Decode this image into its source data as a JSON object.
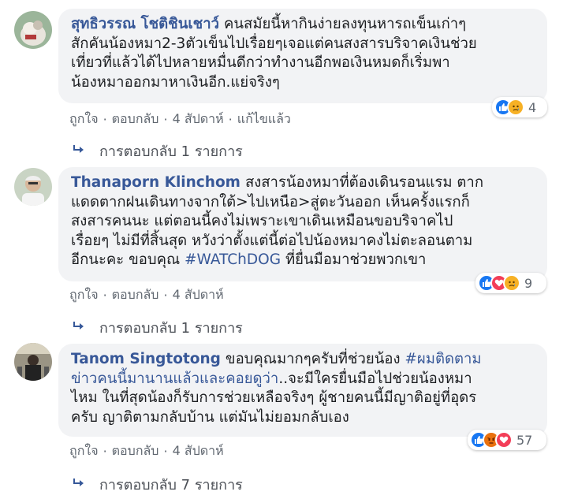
{
  "comments": [
    {
      "author": "สุทธิวรรณ โชติชินเชาว์",
      "lines": [
        "คนสมัยนี้หากินง่ายลงทุนหารถเข็นเก่าๆ",
        "สักคันน้องหมา2-3ตัวเข็นไปเรื่อยๆเจอแต่คนสงสารบริจาคเงินช่วย",
        "เที่ยวที่แล้วได้ไปหลายหมื่นดีกว่าทำงานอีกพอเงินหมดก็เริ่มพา",
        "น้องหมาออกมาหาเงินอีก.แย่จริงๆ"
      ],
      "reaction_count": "4",
      "actions": [
        "ถูกใจ",
        "ตอบกลับ",
        "4 สัปดาห์",
        "แก้ไขแล้ว"
      ],
      "replies": "การตอบกลับ 1 รายการ"
    },
    {
      "author": "Thanaporn Klinchom",
      "lines": [
        "สงสารน้องหมาที่ต้องเดินรอนแรม ตาก",
        "แดดตากฝนเดินทางจากใต้>ไปเหนือ>สู่ตะวันออก เห็นครั้งแรกก็",
        "สงสารคนนะ แต่ตอนนี้คงไม่เพราะเขาเดินเหมือนขอบริจาคไป",
        "เรื่อยๆ ไม่มีที่สิ้นสุด หวังว่าตั้งแต่นี้ต่อไปน้องหมาคงไม่ตะลอนตาม",
        "อีกนะคะ ขอบคุณ"
      ],
      "hashtag": "#WATChDOG",
      "tail": "ที่ยื่นมือมาช่วยพวกเขา",
      "reaction_count": "9",
      "actions": [
        "ถูกใจ",
        "ตอบกลับ",
        "4 สัปดาห์"
      ],
      "replies": "การตอบกลับ 1 รายการ"
    },
    {
      "author": "Tanom Singtotong",
      "line1": "ขอบคุณมากๆครับที่ช่วยน้อง",
      "hashtag": "#ผมติดตาม",
      "line2_hashtag": "ข่าวคนนี้มานานแล้วและคอยดูว่า",
      "line2_tail": "..จะมีใครยื่นมือไปช่วยน้องหมา",
      "lines": [
        "ไหม ในที่สุดน้องก็รับการช่วยเหลือจริงๆ ผู้ชายคนนี้มีญาติอยู่ที่อุดร",
        "ครับ ญาติตามกลับบ้าน แต่มันไม่ยอมกลับเอง"
      ],
      "reaction_count": "57",
      "actions": [
        "ถูกใจ",
        "ตอบกลับ",
        "4 สัปดาห์"
      ],
      "replies": "การตอบกลับ 7 รายการ"
    }
  ],
  "reactions": {
    "like_color": "#1877f2",
    "love_color": "#f33e58",
    "sad_color": "#f7b125",
    "angry_color": "#e9710f"
  },
  "icons": [
    "like-icon",
    "love-icon",
    "sad-icon",
    "angry-icon",
    "reply-arrow-icon"
  ]
}
